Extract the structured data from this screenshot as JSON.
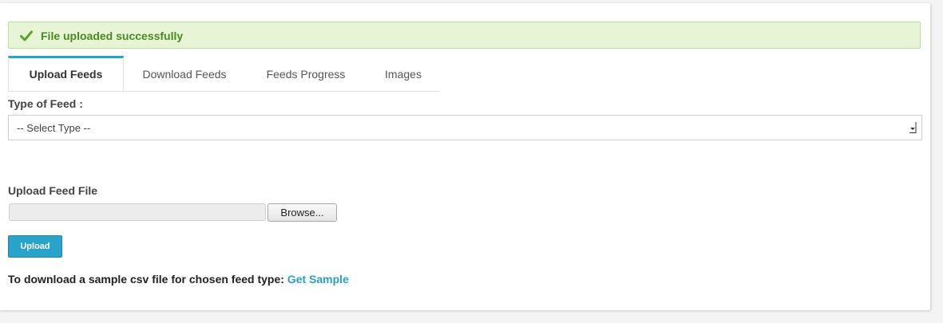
{
  "alert": {
    "icon": "checkmark-icon",
    "message": "File uploaded successfully",
    "color": "#4a8a1c",
    "background": "#e7f5d6"
  },
  "tabs": [
    {
      "label": "Upload Feeds",
      "active": true
    },
    {
      "label": "Download Feeds",
      "active": false
    },
    {
      "label": "Feeds Progress",
      "active": false
    },
    {
      "label": "Images",
      "active": false
    }
  ],
  "form": {
    "type_label": "Type of Feed :",
    "type_select_value": "-- Select Type --",
    "file_label": "Upload Feed File",
    "file_value": "",
    "browse_label": "Browse...",
    "upload_label": "Upload"
  },
  "sample": {
    "text": "To download a sample csv file for chosen feed type:",
    "link_label": "Get Sample"
  },
  "colors": {
    "accent": "#2aa3cb",
    "link": "#2a9fc7"
  }
}
